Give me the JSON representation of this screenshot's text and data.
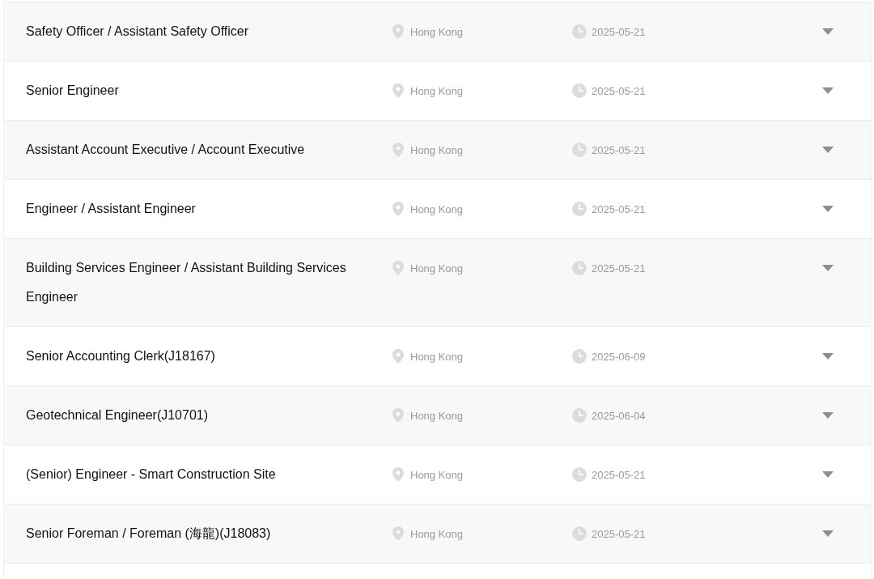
{
  "jobs": [
    {
      "title": "Safety Officer / Assistant Safety Officer",
      "location": "Hong Kong",
      "date": "2025-05-21"
    },
    {
      "title": "Senior Engineer",
      "location": "Hong Kong",
      "date": "2025-05-21"
    },
    {
      "title": "Assistant Account Executive / Account Executive",
      "location": "Hong Kong",
      "date": "2025-05-21"
    },
    {
      "title": "Engineer / Assistant Engineer",
      "location": "Hong Kong",
      "date": "2025-05-21"
    },
    {
      "title": "Building Services Engineer / Assistant Building Services Engineer",
      "location": "Hong Kong",
      "date": "2025-05-21"
    },
    {
      "title": "Senior Accounting Clerk(J18167)",
      "location": "Hong Kong",
      "date": "2025-06-09"
    },
    {
      "title": "Geotechnical Engineer(J10701)",
      "location": "Hong Kong",
      "date": "2025-06-04"
    },
    {
      "title": "(Senior) Engineer - Smart Construction Site",
      "location": "Hong Kong",
      "date": "2025-05-21"
    },
    {
      "title": "Senior Foreman / Foreman (海龍)(J18083)",
      "location": "Hong Kong",
      "date": "2025-05-21"
    }
  ]
}
